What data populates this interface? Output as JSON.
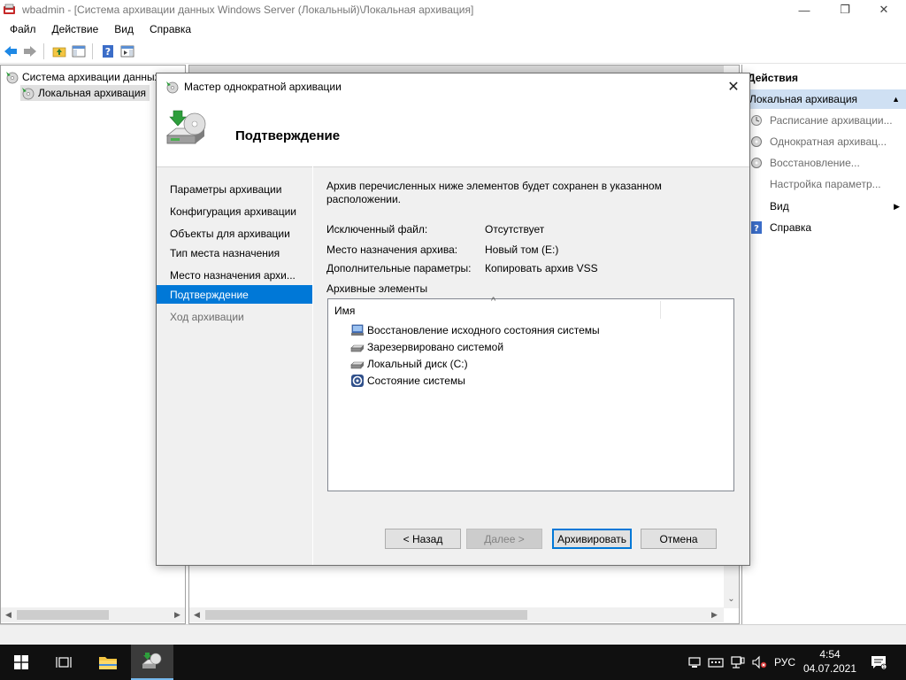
{
  "window": {
    "title": "wbadmin - [Система архивации данных Windows Server (Локальный)\\Локальная архивация]",
    "minimize": "—",
    "maximize": "❐",
    "close": "✕"
  },
  "menu": [
    "Файл",
    "Действие",
    "Вид",
    "Справка"
  ],
  "tree": {
    "root": "Система архивации данных W",
    "child": "Локальная архивация"
  },
  "actions": {
    "title": "Действия",
    "group": "Локальная архивация",
    "items": [
      {
        "label": "Расписание архивации...",
        "disabled": true
      },
      {
        "label": "Однократная архивац...",
        "disabled": true
      },
      {
        "label": "Восстановление...",
        "disabled": true
      },
      {
        "label": "Настройка параметр...",
        "disabled": true
      },
      {
        "label": "Вид",
        "disabled": false
      },
      {
        "label": "Справка",
        "disabled": false
      }
    ]
  },
  "dialog": {
    "title": "Мастер однократной архивации",
    "close": "✕",
    "header": "Подтверждение",
    "steps": [
      {
        "label": "Параметры архивации",
        "state": "done"
      },
      {
        "label": "Конфигурация архивации",
        "state": "done"
      },
      {
        "label": "Объекты для архивации",
        "state": "done"
      },
      {
        "label": "Тип места назначения",
        "state": "done"
      },
      {
        "label": "Место назначения архи...",
        "state": "done"
      },
      {
        "label": "Подтверждение",
        "state": "active"
      },
      {
        "label": "Ход архивации",
        "state": "future"
      }
    ],
    "intro": "Архив перечисленных ниже элементов будет сохранен в указанном расположении.",
    "details": [
      {
        "label": "Исключенный файл:",
        "value": "Отсутствует"
      },
      {
        "label": "Место назначения архива:",
        "value": "Новый том (E:)"
      },
      {
        "label": "Дополнительные параметры:",
        "value": "Копировать архив VSS"
      }
    ],
    "items_label": "Архивные элементы",
    "column_name": "Имя",
    "items": [
      {
        "label": "Восстановление исходного состояния системы",
        "icon": "bare-metal-icon"
      },
      {
        "label": "Зарезервировано системой",
        "icon": "drive-icon"
      },
      {
        "label": "Локальный диск (C:)",
        "icon": "drive-icon"
      },
      {
        "label": "Состояние системы",
        "icon": "system-state-icon"
      }
    ],
    "buttons": {
      "back": "< Назад",
      "next": "Далее >",
      "backup": "Архивировать",
      "cancel": "Отмена"
    }
  },
  "taskbar": {
    "language": "РУС",
    "time": "4:54",
    "date": "04.07.2021"
  },
  "colors": {
    "accent": "#0078d7",
    "actions_group_bg": "#cfe0f3",
    "taskbar_bg": "#101010"
  }
}
